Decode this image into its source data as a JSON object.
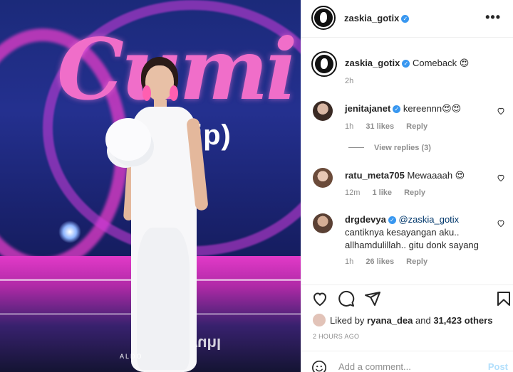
{
  "photo": {
    "brand_text": "Cumi",
    "brand_sub": "Mirip)",
    "stage_text": "wuhl",
    "credit": "ALDO"
  },
  "header": {
    "username": "zaskia_gotix",
    "more_label": "•••"
  },
  "caption": {
    "username": "zaskia_gotix",
    "text": "Comeback 😍",
    "time": "2h"
  },
  "comments": [
    {
      "username": "jenitajanet",
      "verified": true,
      "text": "kereennn😍😍",
      "time": "1h",
      "likes": "31 likes",
      "reply": "Reply",
      "view_replies": "View replies (3)"
    },
    {
      "username": "ratu_meta705",
      "verified": false,
      "text": "Mewaaaah 😍",
      "time": "12m",
      "likes": "1 like",
      "reply": "Reply"
    },
    {
      "username": "drgdevya",
      "verified": true,
      "mention": "@zaskia_gotix",
      "text": "cantiknya kesayangan aku.. allhamdulillah.. gitu donk sayang",
      "time": "1h",
      "likes": "26 likes",
      "reply": "Reply"
    }
  ],
  "likes": {
    "prefix": "Liked by",
    "user": "ryana_dea",
    "middle": "and",
    "count": "31,423 others"
  },
  "post_time": "2 HOURS AGO",
  "add_comment": {
    "placeholder": "Add a comment...",
    "post_label": "Post"
  },
  "colors": {
    "verified": "#3897f0",
    "text": "#262626",
    "muted": "#8e8e8e",
    "post_disabled": "#b2dffc",
    "heart_red": "#ed4956"
  }
}
